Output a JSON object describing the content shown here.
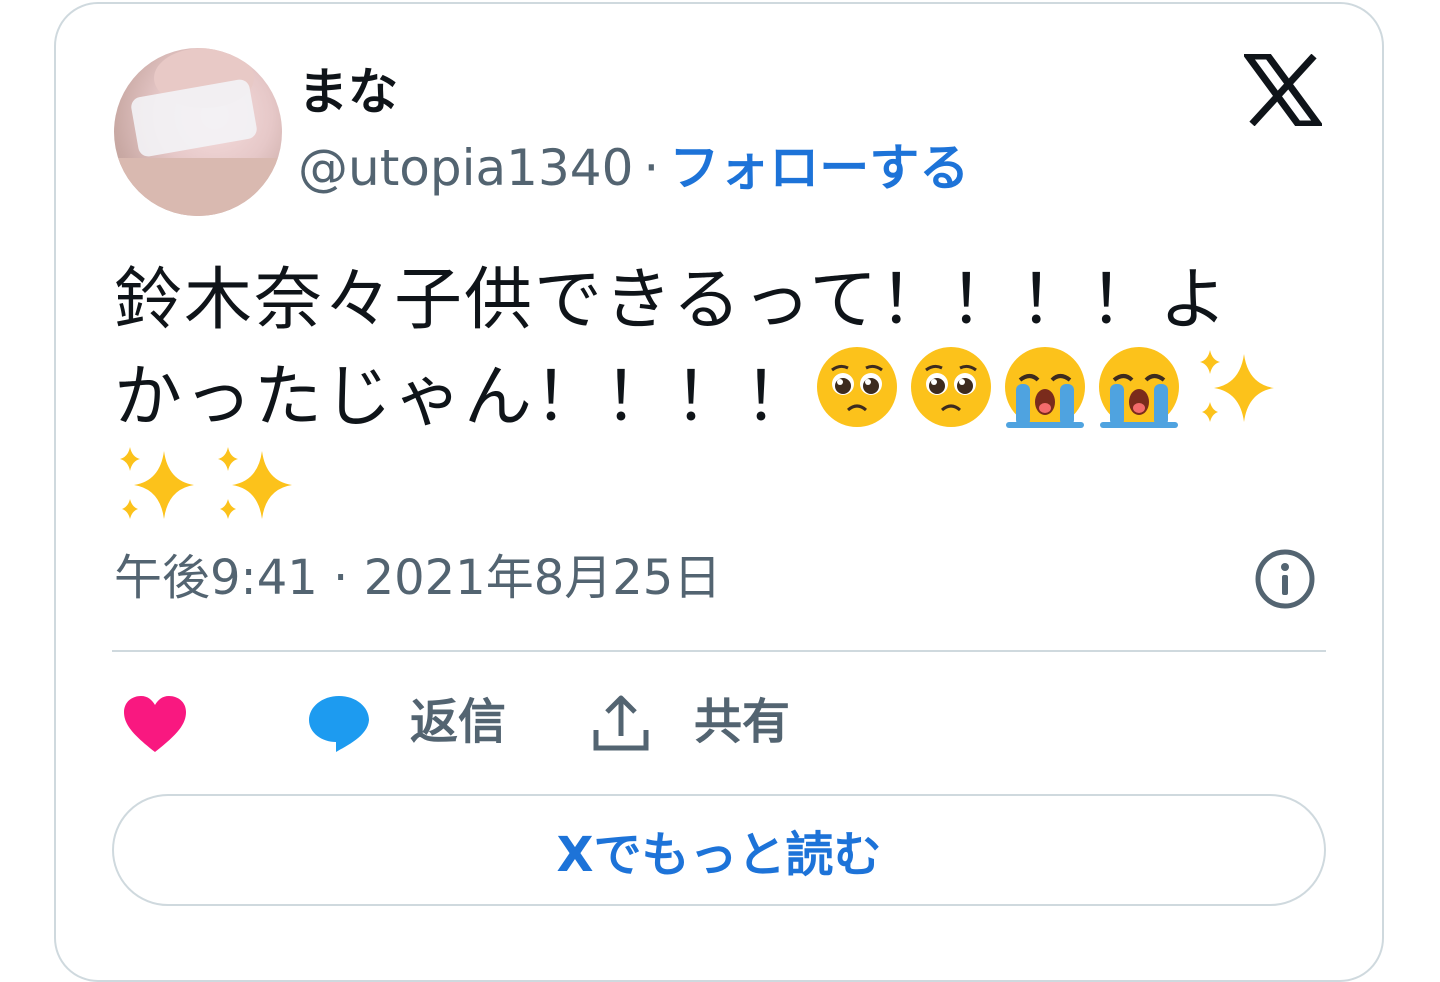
{
  "user": {
    "display_name": "まな",
    "handle": "@utopia1340",
    "separator": "·",
    "follow_label": "フォローする"
  },
  "tweet": {
    "line1": "鈴木奈々子供できるって！！！！よ",
    "line2": "かったじゃん！！！！",
    "emojis": [
      "pleading-face",
      "pleading-face",
      "loudly-crying-face",
      "loudly-crying-face",
      "sparkles",
      "sparkles",
      "sparkles"
    ],
    "timestamp": "午後9:41 · 2021年8月25日"
  },
  "actions": {
    "reply_label": "返信",
    "share_label": "共有"
  },
  "read_more_label": "Xでもっと読む",
  "colors": {
    "accent": "#1d73d8",
    "heart": "#f91880",
    "reply_bubble": "#1d9bf0",
    "muted": "#536471",
    "border": "#cfd9de"
  }
}
